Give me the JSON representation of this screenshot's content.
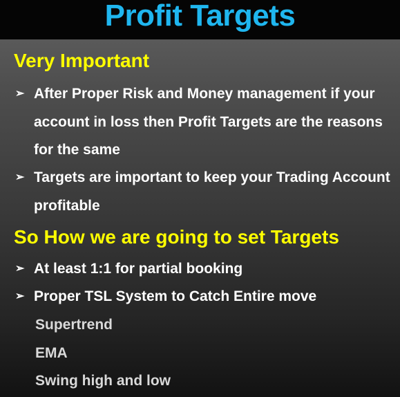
{
  "slide": {
    "title": "Profit Targets",
    "section1": {
      "heading": "Very Important",
      "bullets": [
        "After Proper Risk and Money management if your account in loss then Profit Targets are the reasons for the same",
        "Targets are important to keep your Trading Account profitable"
      ]
    },
    "section2": {
      "heading": "So How we are going to set Targets",
      "bullets": [
        "At least 1:1 for partial booking",
        "Proper TSL System to Catch Entire move"
      ],
      "sub_items": [
        "Supertrend",
        "EMA",
        "Swing high and low"
      ]
    },
    "bullet_glyph": "➢",
    "colors": {
      "title": "#1fb6ef",
      "heading": "#ffff00",
      "body_text": "#ffffff",
      "sub_text": "#d9d9d9",
      "title_bar": "#050505"
    }
  }
}
